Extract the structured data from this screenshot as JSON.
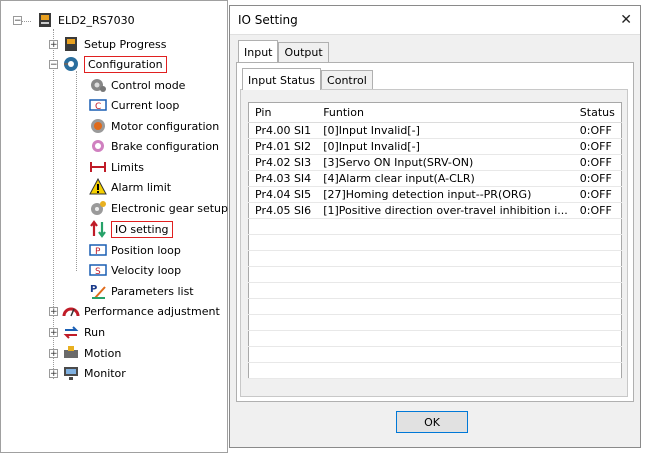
{
  "tree": {
    "root": "ELD2_RS7030",
    "items": [
      {
        "label": "Setup Progress"
      },
      {
        "label": "Configuration"
      },
      {
        "label": "Control mode"
      },
      {
        "label": "Current loop"
      },
      {
        "label": "Motor configuration"
      },
      {
        "label": "Brake configuration"
      },
      {
        "label": "Limits"
      },
      {
        "label": "Alarm limit"
      },
      {
        "label": "Electronic gear setup"
      },
      {
        "label": "IO setting"
      },
      {
        "label": "Position loop"
      },
      {
        "label": "Velocity loop"
      },
      {
        "label": "Parameters list"
      },
      {
        "label": "Performance adjustment"
      },
      {
        "label": "Run"
      },
      {
        "label": "Motion"
      },
      {
        "label": "Monitor"
      }
    ]
  },
  "dialog": {
    "title": "IO Setting",
    "close_icon": "close-icon",
    "tabs": [
      "Input",
      "Output"
    ],
    "subtabs": [
      "Input Status",
      "Control"
    ],
    "columns": [
      "Pin",
      "Funtion",
      "Status"
    ],
    "rows": [
      [
        "Pr4.00 SI1",
        "[0]Input Invalid[-]",
        "0:OFF"
      ],
      [
        "Pr4.01 SI2",
        "[0]Input Invalid[-]",
        "0:OFF"
      ],
      [
        "Pr4.02 SI3",
        "[3]Servo ON Input(SRV-ON)",
        "0:OFF"
      ],
      [
        "Pr4.03 SI4",
        "[4]Alarm clear input(A-CLR)",
        "0:OFF"
      ],
      [
        "Pr4.04 SI5",
        "[27]Homing detection input--PR(ORG)",
        "0:OFF"
      ],
      [
        "Pr4.05 SI6",
        "[1]Positive direction over-travel inhibition i...",
        "0:OFF"
      ]
    ],
    "ok_label": "OK"
  },
  "colors": {
    "highlight": "#e02020",
    "accent": "#0078d7"
  }
}
